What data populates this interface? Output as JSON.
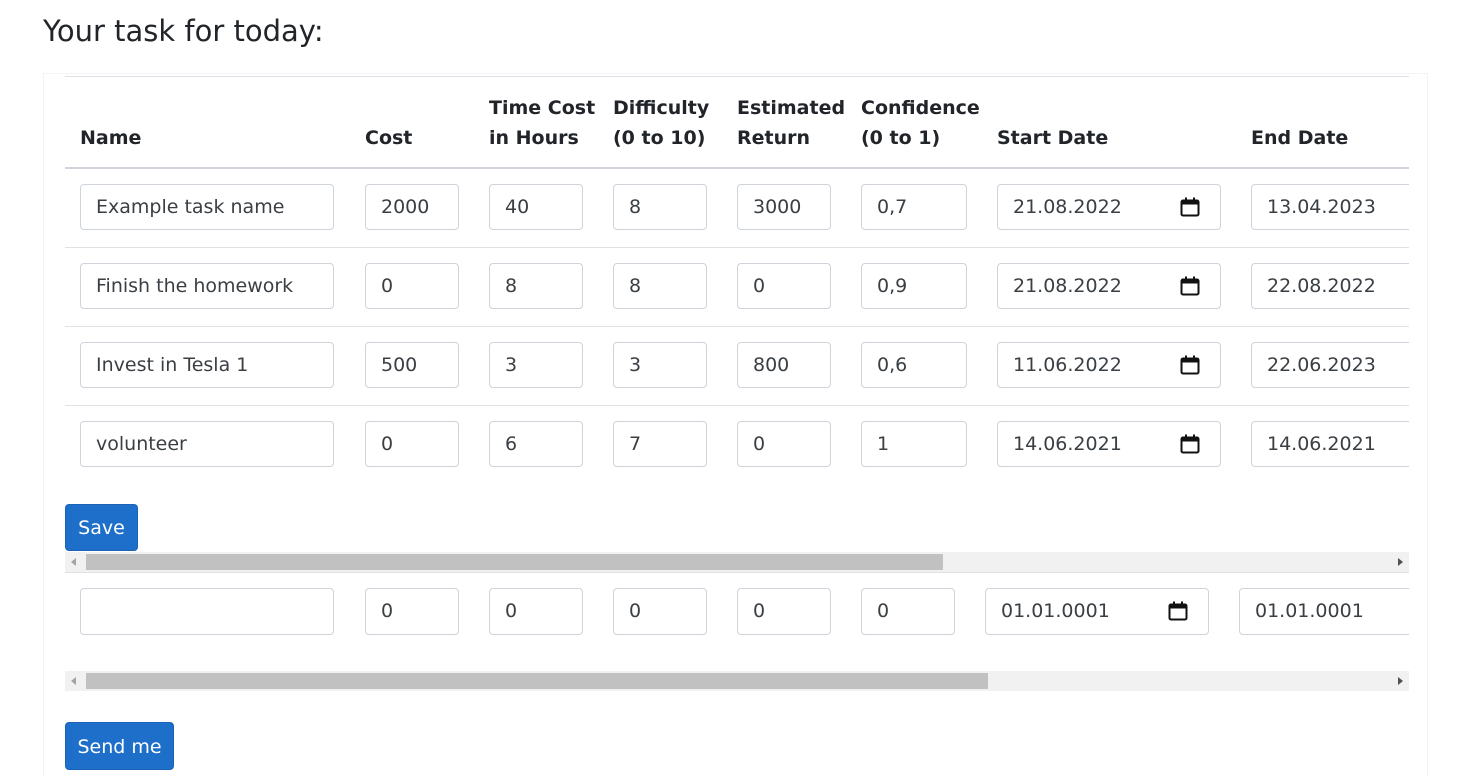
{
  "page": {
    "title": "Your task for today:"
  },
  "headers": {
    "name": "Name",
    "cost": "Cost",
    "time_cost": [
      "Time Cost",
      "in Hours"
    ],
    "difficulty": [
      "Difficulty",
      "(0 to 10)"
    ],
    "estimated_return": [
      "Estimated",
      "Return"
    ],
    "confidence": [
      "Confidence",
      "(0 to 1)"
    ],
    "start_date": "Start Date",
    "end_date": "End Date"
  },
  "rows": [
    {
      "name": "Example task name",
      "cost": "2000",
      "time": "40",
      "difficulty": "8",
      "return": "3000",
      "confidence": "0,7",
      "start": "21.08.2022",
      "end": "13.04.2023"
    },
    {
      "name": "Finish the homework",
      "cost": "0",
      "time": "8",
      "difficulty": "8",
      "return": "0",
      "confidence": "0,9",
      "start": "21.08.2022",
      "end": "22.08.2022"
    },
    {
      "name": "Invest in Tesla 1",
      "cost": "500",
      "time": "3",
      "difficulty": "3",
      "return": "800",
      "confidence": "0,6",
      "start": "11.06.2022",
      "end": "22.06.2023"
    },
    {
      "name": "volunteer",
      "cost": "0",
      "time": "6",
      "difficulty": "7",
      "return": "0",
      "confidence": "1",
      "start": "14.06.2021",
      "end": "14.06.2021"
    }
  ],
  "new_row": {
    "name": "",
    "cost": "0",
    "time": "0",
    "difficulty": "0",
    "return": "0",
    "confidence": "0",
    "start": "01.01.0001",
    "end": "01.01.0001"
  },
  "buttons": {
    "save": "Save",
    "send": "Send me"
  },
  "scroll": {
    "table_position": 0.64,
    "form_position": 0.68
  },
  "colors": {
    "primary": "#1d6fc9",
    "border": "#ced4da"
  },
  "icons": {
    "date_picker": "calendar-icon"
  }
}
